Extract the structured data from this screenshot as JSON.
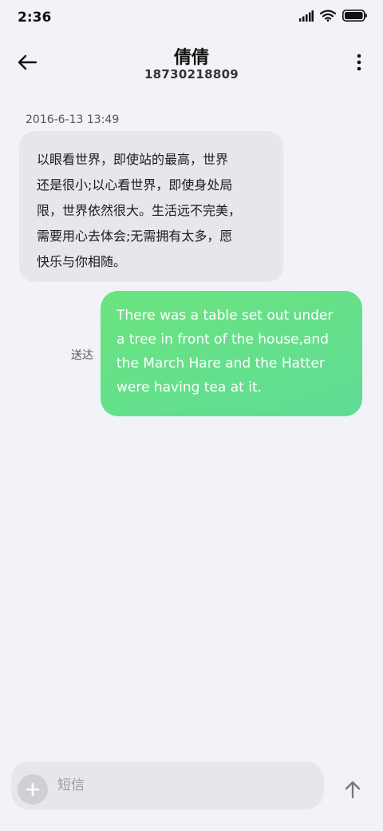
{
  "status_bar": {
    "time": "2:36"
  },
  "header": {
    "contact_name": "倩倩",
    "contact_number": "18730218809"
  },
  "messages": {
    "timestamp": "2016-6-13 13:49",
    "incoming": [
      "以眼看世界，即使站的最高，世界",
      "还是很小;以心看世界，即使身处局",
      "限，世界依然很大。生活远不完美，",
      "需要用心去体会;无需拥有太多，愿",
      "快乐与你相随。"
    ],
    "outgoing": [
      "There was a table set out under",
      "a tree in front of the house,and",
      "the March Hare and the Hatter",
      "were having tea at it."
    ],
    "delivery_status": "送达"
  },
  "composer": {
    "placeholder": "短信"
  },
  "colors": {
    "outgoing_bubble": "#6be47e",
    "incoming_bubble": "#e6e7ec",
    "background": "#f2f3f9"
  }
}
